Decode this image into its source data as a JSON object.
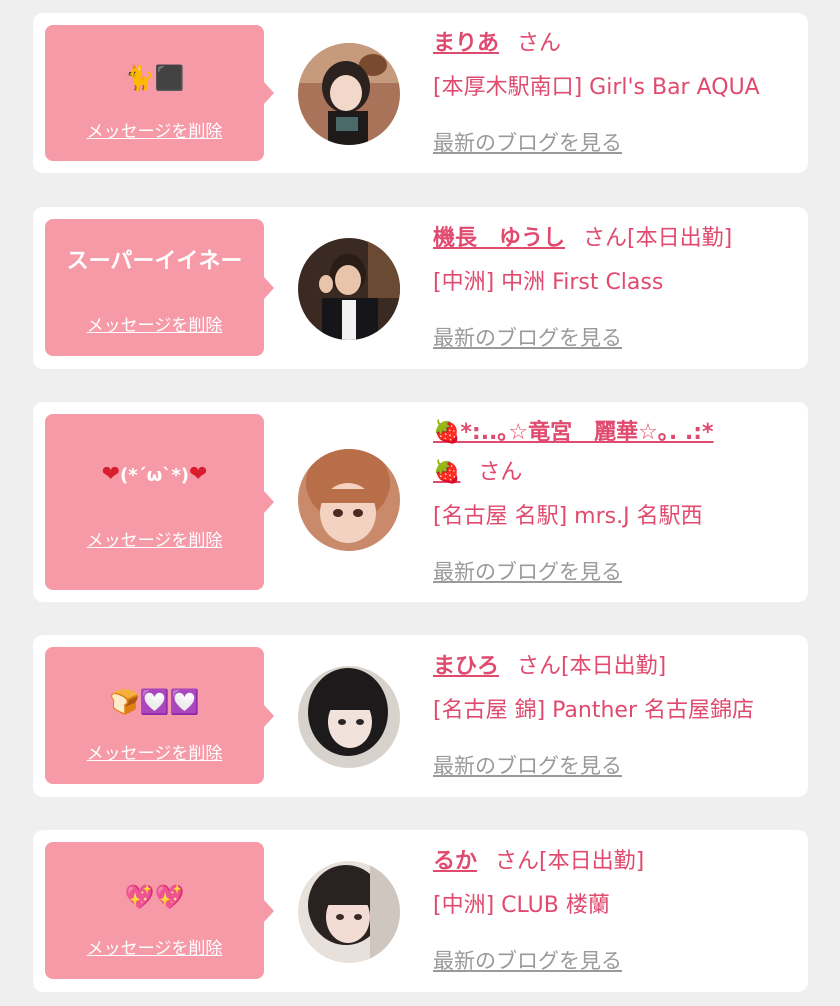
{
  "common": {
    "delete_label": "メッセージを削除",
    "blog_label": "最新のブログを見る",
    "honorific": "さん"
  },
  "messages": [
    {
      "stamp": "🐈⬛",
      "name": "まりあ",
      "status": "",
      "shop": "[本厚木駅南口] Girl's Bar AQUA"
    },
    {
      "stamp": "スーパーイイネー",
      "name": "機長　ゆうし",
      "status": "[本日出勤]",
      "shop": "[中洲] 中洲 First Class"
    },
    {
      "stamp_parts": [
        "❤",
        "(*´ω`*)",
        "❤"
      ],
      "name": "🍓*:..｡☆竜宮　麗華☆｡. .:*",
      "name_cont": "🍓",
      "status": "",
      "shop": "[名古屋 名駅] mrs.J 名駅西"
    },
    {
      "stamp": "🍞💟💟",
      "name": "まひろ",
      "status": "[本日出勤]",
      "shop": "[名古屋 錦] Panther 名古屋錦店"
    },
    {
      "stamp": "💖💖",
      "name": "るか",
      "status": "[本日出勤]",
      "shop": "[中洲] CLUB 楼蘭"
    }
  ]
}
